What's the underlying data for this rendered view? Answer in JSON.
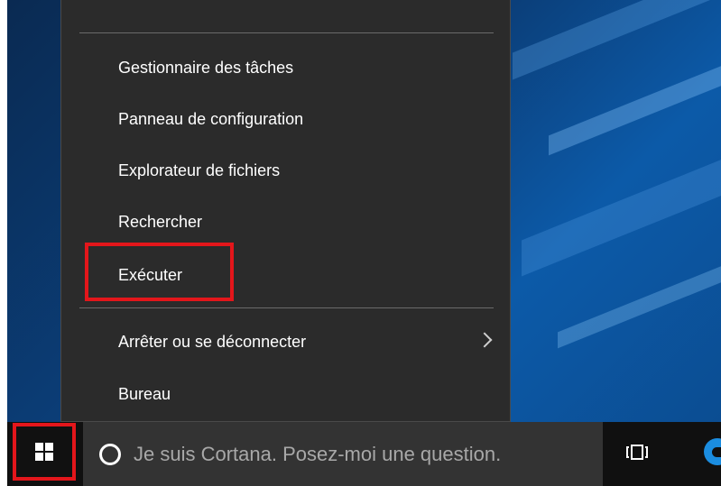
{
  "menu": {
    "items": [
      {
        "label": "Gestionnaire des tâches"
      },
      {
        "label": "Panneau de configuration"
      },
      {
        "label": "Explorateur de fichiers"
      },
      {
        "label": "Rechercher"
      },
      {
        "label": "Exécuter"
      },
      {
        "label": "Arrêter ou se déconnecter",
        "submenu": true
      },
      {
        "label": "Bureau"
      }
    ],
    "highlighted_item": "Exécuter"
  },
  "taskbar": {
    "start_icon": "windows-logo-icon",
    "search_placeholder": "Je suis Cortana. Posez-moi une question.",
    "task_view_icon": "task-view-icon",
    "edge_icon": "edge-browser-icon"
  },
  "colors": {
    "menu_bg": "#2b2b2b",
    "taskbar_bg": "#101010",
    "search_bg": "#333333",
    "highlight_border": "#e3161b"
  }
}
